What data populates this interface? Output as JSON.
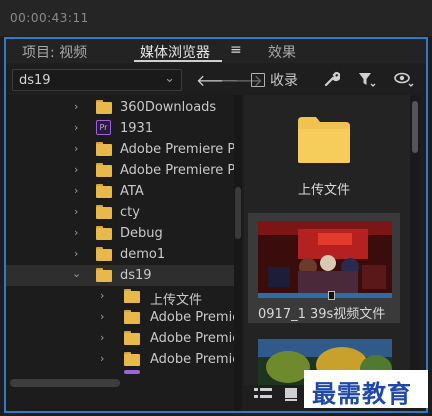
{
  "timecode": "00:00:43:11",
  "tabs": [
    {
      "label": "项目: 视频",
      "active": false
    },
    {
      "label": "媒体浏览器",
      "active": true
    },
    {
      "label": "效果",
      "active": false
    }
  ],
  "tab_menu_icon": "hamburger-icon",
  "toolbar": {
    "location_value": "ds19",
    "collect_label": "收录",
    "icons": [
      "back-arrow-icon",
      "forward-arrow-icon",
      "wrench-icon",
      "filter-icon",
      "eye-icon"
    ]
  },
  "tree": [
    {
      "label": "360Downloads",
      "icon": "folder"
    },
    {
      "label": "1931",
      "icon": "premiere-badge",
      "badge_text": "Pr"
    },
    {
      "label": "Adobe Premiere Pr",
      "icon": "folder"
    },
    {
      "label": "Adobe Premiere Pr",
      "icon": "folder"
    },
    {
      "label": "ATA",
      "icon": "folder"
    },
    {
      "label": "cty",
      "icon": "folder"
    },
    {
      "label": "Debug",
      "icon": "folder"
    },
    {
      "label": "demo1",
      "icon": "folder"
    },
    {
      "label": "ds19",
      "icon": "folder",
      "expanded": true,
      "selected": true
    },
    {
      "label": "上传文件",
      "icon": "folder",
      "child": true
    },
    {
      "label": "Adobe Premie",
      "icon": "folder",
      "child": true
    },
    {
      "label": "Adobe Premie",
      "icon": "folder",
      "child": true
    },
    {
      "label": "Adobe Premie",
      "icon": "folder",
      "child": true
    }
  ],
  "thumbnails": [
    {
      "label": "上传文件",
      "kind": "folder"
    },
    {
      "label": "0917_1  39s视频文件",
      "kind": "video",
      "selected": true,
      "playhead": 0.55
    },
    {
      "label": "",
      "kind": "video"
    }
  ],
  "bottom_icons": [
    "list-view-icon",
    "icon-view-icon",
    "zoom-slider-icon"
  ],
  "watermark": "最需教育",
  "colors": {
    "accent_border": "#2e7cc4",
    "folder": "#e8b84a",
    "premiere_badge": "#9b64d8",
    "watermark_text": "#1f48a8"
  }
}
